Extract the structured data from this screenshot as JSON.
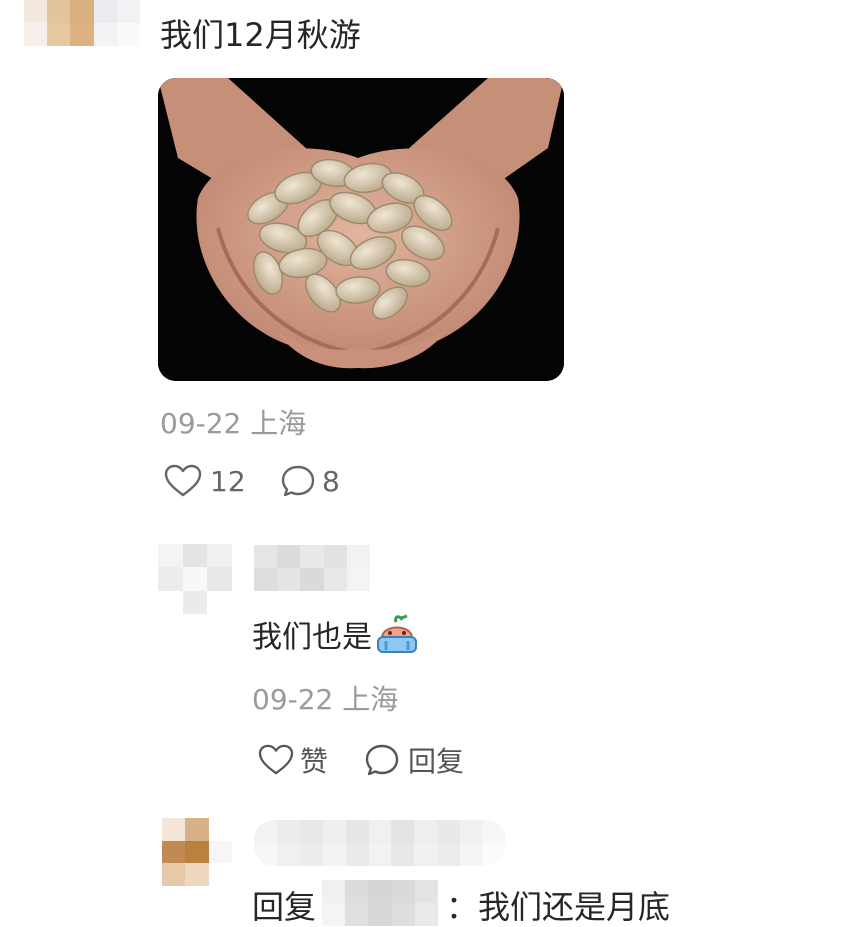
{
  "post": {
    "text": "我们12月秋游",
    "meta": "09-22 上海",
    "likes": "12",
    "comments": "8"
  },
  "replies": [
    {
      "text": "我们也是",
      "meta": "09-22 上海",
      "like_label": "赞",
      "reply_label": "回复"
    },
    {
      "prefix": "回复",
      "suffix": "：我们还是月底"
    }
  ],
  "icons": [
    "heart-icon",
    "comment-bubble-icon",
    "crying-emoji-icon"
  ],
  "colors": {
    "text": "#262626",
    "meta": "#9a9a9a",
    "icon": "#666666",
    "background": "#ffffff"
  }
}
